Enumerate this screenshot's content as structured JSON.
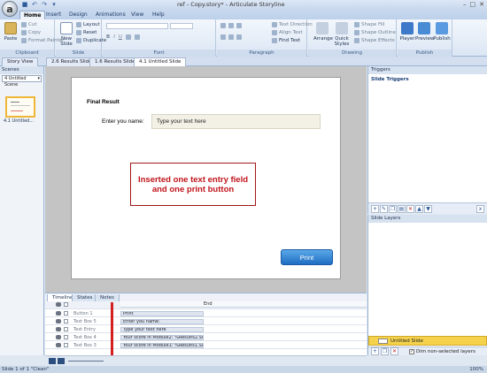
{
  "window": {
    "title": "ref - Copy.story* - Articulate Storyline",
    "controls": [
      "–",
      "□",
      "✕"
    ]
  },
  "ribbon_tabs": [
    "Home",
    "Insert",
    "Design",
    "Animations",
    "View",
    "Help"
  ],
  "ribbon": {
    "clipboard": {
      "label": "Clipboard",
      "paste": "Paste",
      "cut": "Cut",
      "copy": "Copy",
      "format_painter": "Format Painter"
    },
    "slide": {
      "label": "Slide",
      "new_slide": "New Slide",
      "layout": "Layout",
      "reset": "Reset",
      "duplicate": "Duplicate"
    },
    "font": {
      "label": "Font"
    },
    "paragraph": {
      "label": "Paragraph",
      "text_direction": "Text Direction",
      "align_text": "Align Text",
      "find_text": "Find Text"
    },
    "drawing": {
      "label": "Drawing",
      "arrange": "Arrange",
      "quick_styles": "Quick Styles",
      "shape_fill": "Shape Fill",
      "shape_outline": "Shape Outline",
      "shape_effects": "Shape Effects"
    },
    "publish": {
      "label": "Publish",
      "player": "Player",
      "preview": "Preview",
      "publish": "Publish"
    }
  },
  "doc_tabs": [
    "Story View",
    "2.6 Results Slide",
    "1.6 Results Slide",
    "4.1 Untitled Slide"
  ],
  "scenes": {
    "header": "Scenes",
    "selected": "4 Untitled Scene",
    "thumb_label": "4.1 Untitled..."
  },
  "slide": {
    "heading": "Final Result",
    "enter_label": "Enter you name:",
    "text_entry_placeholder": "Type your text here",
    "note": "Inserted one text entry field and one print button",
    "print_button": "Print"
  },
  "timeline": {
    "tabs": [
      "Timeline",
      "States",
      "Notes"
    ],
    "rows": [
      {
        "name": "Button 1",
        "bar": "Print"
      },
      {
        "name": "Text Box 5",
        "bar": "Enter you name:"
      },
      {
        "name": "Text Entry",
        "bar": "Type your text here"
      },
      {
        "name": "Text Box 4",
        "bar": "Your score in Module2: %Results2.Sc..."
      },
      {
        "name": "Text Box 3",
        "bar": "Your score in Module1: %Results1.Sc..."
      }
    ],
    "ruler_label": "End"
  },
  "triggers": {
    "header": "Triggers",
    "slide_triggers": "Slide Triggers"
  },
  "layers": {
    "header": "Slide Layers",
    "base_layer": "Untitled Slide",
    "dim_label": "Dim non-selected layers"
  },
  "status": {
    "left": "Slide 1 of 1   \"Clean\"",
    "zoom": "100%"
  },
  "colors": {
    "accent": "#1f6dc2",
    "note_red": "#c0141b",
    "layer_yellow": "#f5d24c"
  }
}
